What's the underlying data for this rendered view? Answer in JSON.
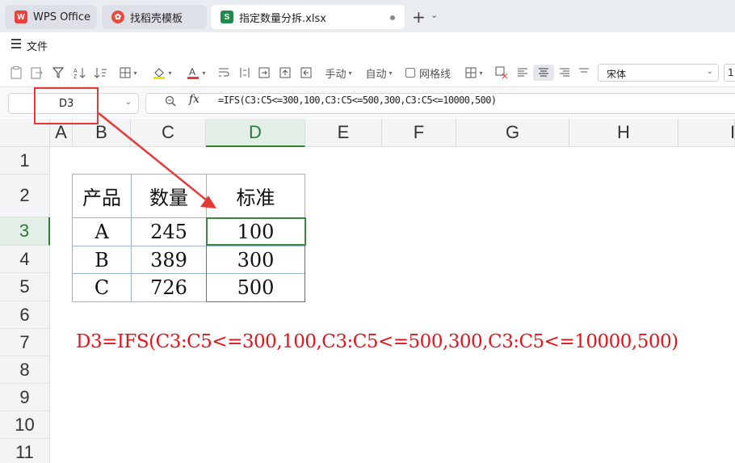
{
  "tabs": {
    "wps": "WPS Office",
    "template": "找稻壳模板",
    "file": "指定数量分拆.xlsx"
  },
  "menu": {
    "file": "文件"
  },
  "toolbar": {
    "manual": "手动",
    "auto": "自动",
    "gridlines": "网格线",
    "font_name": "宋体",
    "font_size": "1"
  },
  "formula_bar": {
    "cell_ref": "D3",
    "fx": "fx",
    "formula": "=IFS(C3:C5<=300,100,C3:C5<=500,300,C3:C5<=10000,500)"
  },
  "grid": {
    "columns": [
      "A",
      "B",
      "C",
      "D",
      "E",
      "F",
      "G",
      "H",
      "I"
    ],
    "rows": [
      "1",
      "2",
      "3",
      "4",
      "5",
      "6",
      "7",
      "8",
      "9",
      "10",
      "11"
    ],
    "active_column": "D",
    "active_row": "3"
  },
  "table": {
    "headers": [
      "产品",
      "数量",
      "标准"
    ],
    "rows": [
      [
        "A",
        "245",
        "100"
      ],
      [
        "B",
        "389",
        "300"
      ],
      [
        "C",
        "726",
        "500"
      ]
    ]
  },
  "annotation": {
    "text": "D3=IFS(C3:C5<=300,100,C3:C5<=500,300,C3:C5<=10000,500)",
    "color": "#e8121a"
  },
  "colors": {
    "accent_green": "#2e7d32",
    "selection_blue": "#3b73d6",
    "annotation_red": "#e53935"
  }
}
